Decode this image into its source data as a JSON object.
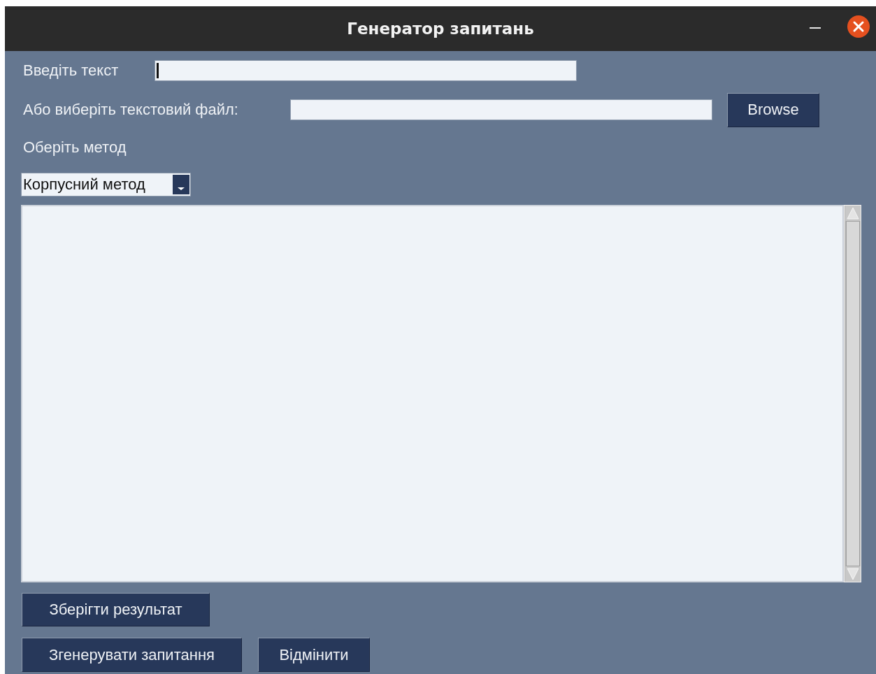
{
  "window": {
    "title": "Генератор запитань"
  },
  "text_input": {
    "label": "Введіть текст",
    "focused": true
  },
  "file_input": {
    "label": "Або виберіть текстовий файл:",
    "button": "Browse"
  },
  "method": {
    "label": "Оберіть метод",
    "value": "Корпусний метод"
  },
  "buttons": [
    {
      "label": "Зберігти результат",
      "kind": "save"
    },
    {
      "label": "Згенерувати запитання",
      "kind": "generate"
    },
    {
      "label": "Відмінити",
      "kind": "cancel"
    }
  ]
}
